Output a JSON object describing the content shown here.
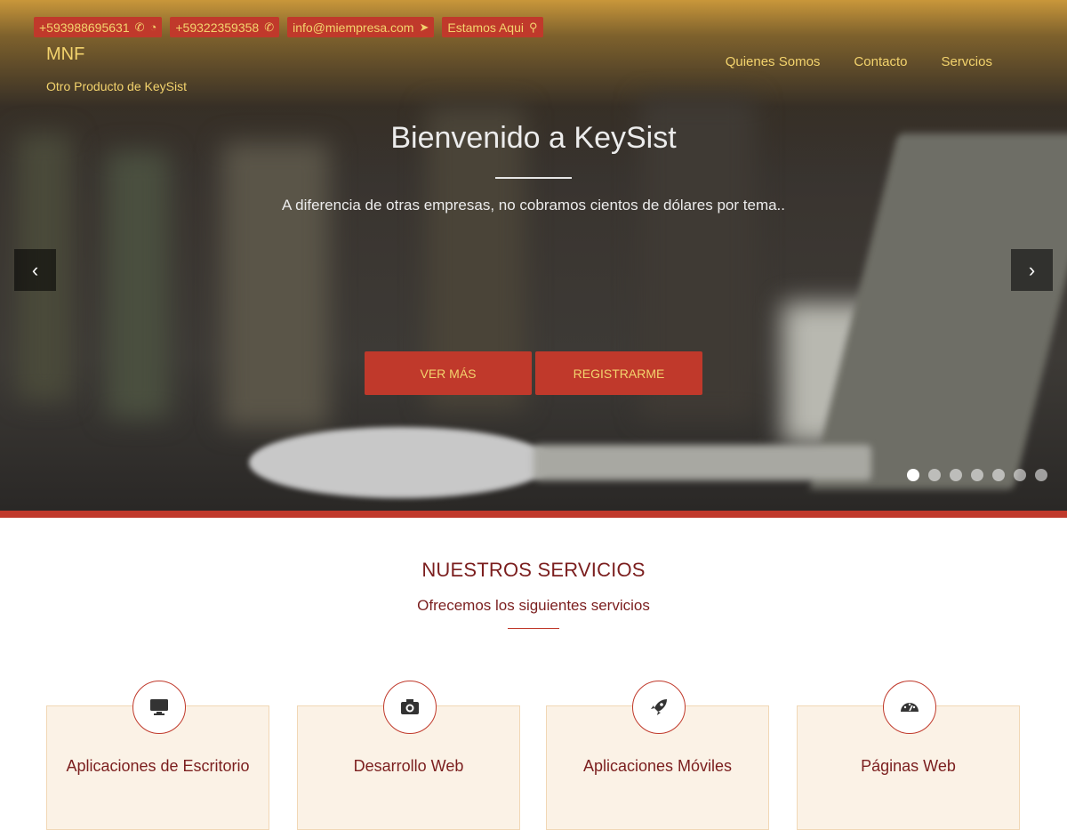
{
  "contact_chips": [
    {
      "text": "+593988695631",
      "icons": [
        "phone-icon",
        "whatsapp-icon"
      ]
    },
    {
      "text": "+59322359358",
      "icons": [
        "phone-icon"
      ]
    },
    {
      "text": "info@miempresa.com",
      "icons": [
        "send-icon"
      ]
    },
    {
      "text": "Estamos Aqui",
      "icons": [
        "map-pin-icon"
      ]
    }
  ],
  "brand": {
    "title": "MNF",
    "subtitle": "Otro Producto de KeySist"
  },
  "nav": {
    "items": [
      "Quienes Somos",
      "Contacto",
      "Servcios"
    ]
  },
  "hero": {
    "title": "Bienvenido a KeySist",
    "subtitle": "A diferencia de otras empresas, no cobramos cientos de dólares por tema..",
    "btn_more": "VER MÁS",
    "btn_register": "REGISTRARME",
    "slides_count": 7,
    "active_slide": 1
  },
  "services": {
    "title": "NUESTROS SERVICIOS",
    "subtitle": "Ofrecemos los siguientes servicios",
    "items": [
      {
        "title": "Aplicaciones de Escritorio",
        "icon": "desktop-icon"
      },
      {
        "title": "Desarrollo Web",
        "icon": "camera-icon"
      },
      {
        "title": "Aplicaciones Móviles",
        "icon": "rocket-icon"
      },
      {
        "title": "Páginas Web",
        "icon": "dashboard-icon"
      }
    ]
  },
  "colors": {
    "accent": "#c0392b",
    "accent_text": "#f3d36d",
    "heading": "#7b1e1e",
    "card_bg": "#fbf2e6"
  }
}
